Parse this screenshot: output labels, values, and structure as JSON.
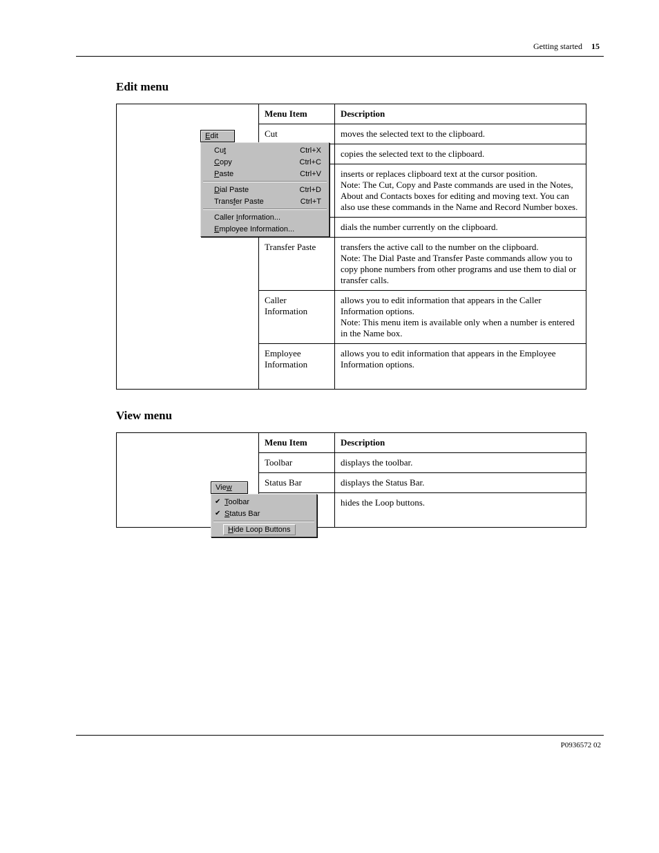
{
  "header": {
    "running": "Getting started",
    "page_no": "15"
  },
  "sections": {
    "edit_title": "Edit menu",
    "view_title": "View menu"
  },
  "table_headers": {
    "item": "Menu Item",
    "desc": "Description"
  },
  "edit_table": {
    "rows": [
      {
        "item": "Cut",
        "desc": "moves the selected text to the clipboard."
      },
      {
        "item": "Copy",
        "desc": "copies the selected text to the clipboard."
      },
      {
        "item": "Paste",
        "desc": "inserts or replaces clipboard text at the cursor position.\nNote: The Cut, Copy and Paste commands are used in the Notes, About and Contacts boxes for editing and moving text. You can also use these commands in the Name and Record Number boxes."
      },
      {
        "item": "Dial Paste",
        "desc": "dials the number currently on the clipboard."
      },
      {
        "item": "Transfer Paste",
        "desc": "transfers the active call to the number on the clipboard.\nNote: The Dial Paste and Transfer Paste commands allow you to copy phone numbers from other programs and use them to dial or transfer calls."
      },
      {
        "item": "Caller Information",
        "desc": "allows you to edit information that appears in the Caller Information options.\nNote: This menu item is available only when a number is entered in the Name box."
      },
      {
        "item": "Employee Information",
        "desc": "allows you to edit information that appears in the Employee Information options."
      }
    ]
  },
  "view_table": {
    "rows": [
      {
        "item": "Toolbar",
        "desc": "displays the toolbar."
      },
      {
        "item": "Status Bar",
        "desc": "displays the Status Bar."
      },
      {
        "item": "Hide Loop Buttons",
        "desc": "hides the Loop buttons."
      }
    ]
  },
  "menus": {
    "edit": {
      "title_pre": "",
      "title_u": "E",
      "title_post": "dit",
      "items": [
        {
          "pre": "Cu",
          "u": "t",
          "post": "",
          "acc": "Ctrl+X"
        },
        {
          "pre": "",
          "u": "C",
          "post": "opy",
          "acc": "Ctrl+C"
        },
        {
          "pre": "",
          "u": "P",
          "post": "aste",
          "acc": "Ctrl+V"
        },
        {
          "sep": true
        },
        {
          "pre": "",
          "u": "D",
          "post": "ial Paste",
          "acc": "Ctrl+D"
        },
        {
          "pre": "Trans",
          "u": "f",
          "post": "er Paste",
          "acc": "Ctrl+T"
        },
        {
          "sep": true
        },
        {
          "pre": "Caller ",
          "u": "I",
          "post": "nformation...",
          "acc": ""
        },
        {
          "pre": "",
          "u": "E",
          "post": "mployee Information...",
          "acc": ""
        }
      ]
    },
    "view": {
      "title_pre": "Vie",
      "title_u": "w",
      "title_post": "",
      "items": [
        {
          "check": true,
          "pre": "",
          "u": "T",
          "post": "oolbar"
        },
        {
          "check": true,
          "pre": "",
          "u": "S",
          "post": "tatus Bar"
        },
        {
          "sep": true
        },
        {
          "btn": true,
          "pre": "",
          "u": "H",
          "post": "ide Loop Buttons"
        }
      ]
    }
  },
  "footer": "P0936572 02"
}
